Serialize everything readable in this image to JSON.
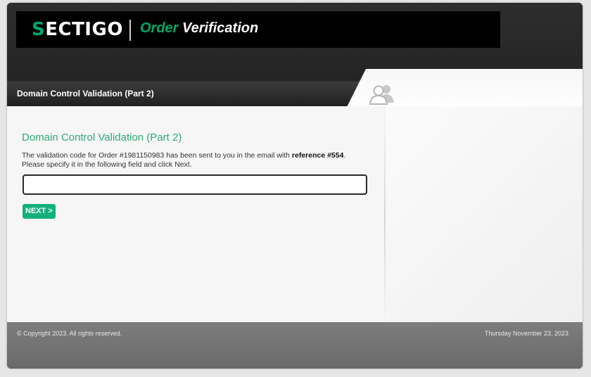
{
  "brand": {
    "logo_mark": "S",
    "logo_text": "ECTIGO",
    "product_accent": "Order",
    "product_rest": " Verification",
    "accent_color": "#00a86b"
  },
  "header": {
    "page_title": "Domain Control Validation (Part 2)",
    "user_icon": "users-icon"
  },
  "main": {
    "section_title": "Domain Control Validation (Part 2)",
    "description_prefix": "The validation code for Order #1981150983 has been sent to you in the email with ",
    "description_reference": "reference #554",
    "description_suffix": ".",
    "description_line2": "Please specify it in the following field and click Next.",
    "code_input_value": "",
    "next_button_label": "NEXT >"
  },
  "footer": {
    "copyright": "© Copyright 2023. All rights reserved.",
    "date": "Thursday November 23, 2023"
  }
}
